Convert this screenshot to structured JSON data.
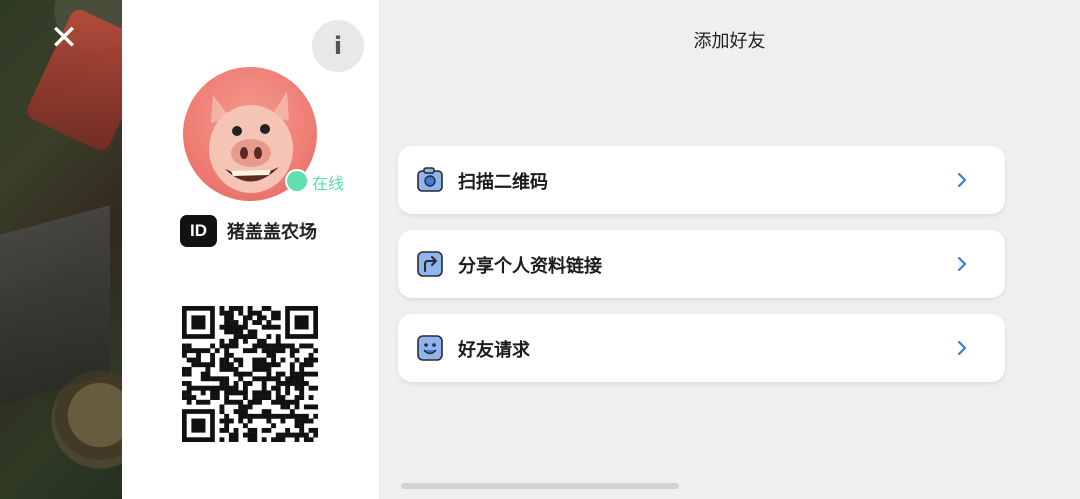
{
  "close_button": {
    "icon": "close-icon",
    "glyph": "✕"
  },
  "profile": {
    "info_button": {
      "icon": "info-icon",
      "glyph": "i"
    },
    "avatar": {
      "icon": "pig-avatar"
    },
    "status": {
      "label": "在线",
      "color": "#5fe0b0"
    },
    "id_badge": "ID",
    "name": "猪盖盖农场",
    "qr_code": {
      "icon": "qr-code"
    }
  },
  "main": {
    "title": "添加好友",
    "items": [
      {
        "label": "扫描二维码",
        "icon": "camera-icon"
      },
      {
        "label": "分享个人资料链接",
        "icon": "share-arrow-icon"
      },
      {
        "label": "好友请求",
        "icon": "smiley-face-icon"
      }
    ],
    "accent_color": "#3d7bdc"
  }
}
